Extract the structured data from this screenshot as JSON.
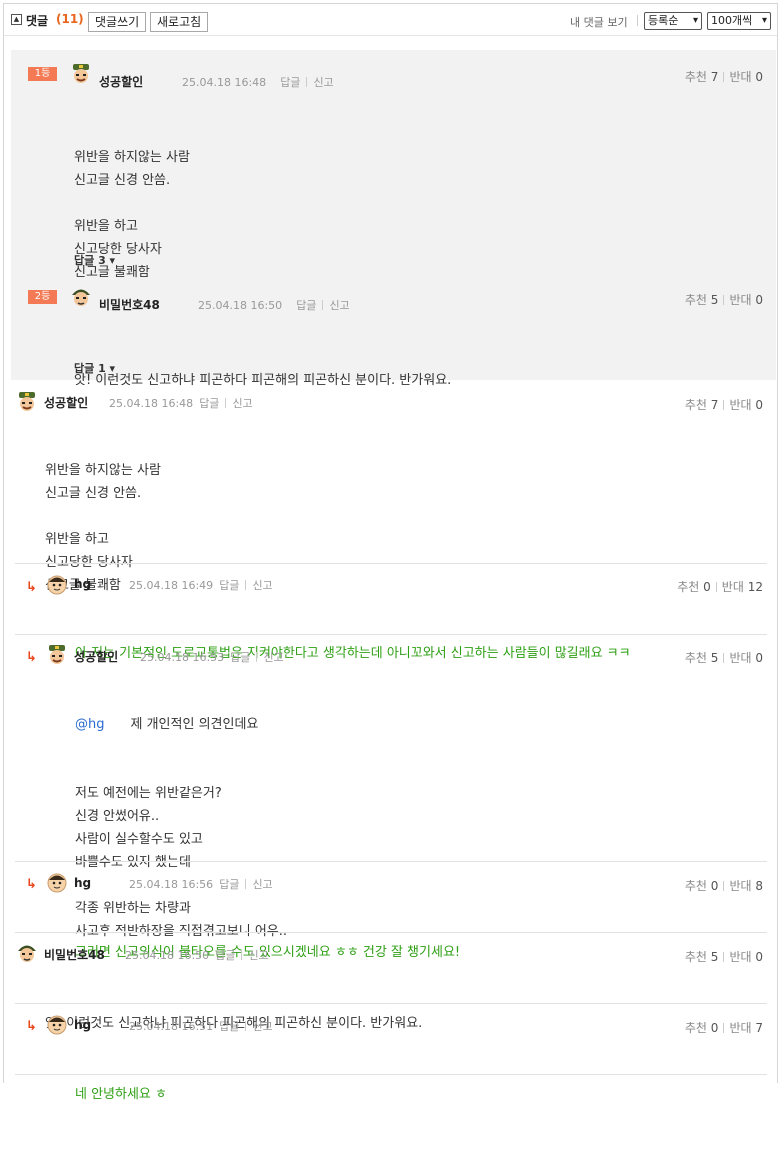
{
  "header": {
    "title": "댓글",
    "count": "(11)",
    "write_label": "댓글쓰기",
    "refresh_label": "새로고침",
    "my_comments_label": "내 댓글 보기",
    "sort_selected": "등록순",
    "per_page_selected": "100개씩"
  },
  "best": [
    {
      "rank": "1등",
      "name": "성공할인",
      "time": "25.04.18 16:48",
      "reply": "답글",
      "report": "신고",
      "recommend_label": "추천",
      "recommend": "7",
      "oppose_label": "반대",
      "oppose": "0",
      "lines": [
        "위반을 하지않는 사람",
        "신고글 신경 안씀.",
        "",
        "위반을 하고",
        "신고당한 당사자",
        "신고글 불쾌함"
      ],
      "replies_toggle": "답글 3 ▾"
    },
    {
      "rank": "2등",
      "name": "비밀번호48",
      "time": "25.04.18 16:50",
      "reply": "답글",
      "report": "신고",
      "recommend_label": "추천",
      "recommend": "5",
      "oppose_label": "반대",
      "oppose": "0",
      "lines": [
        "앗! 이런것도 신고하냐 피곤하다 피곤해의 피곤하신 분이다. 반가워요."
      ],
      "replies_toggle": "답글 1 ▾"
    }
  ],
  "comments": [
    {
      "name": "성공할인",
      "time": "25.04.18 16:48",
      "reply": "답글",
      "report": "신고",
      "recommend_label": "추천",
      "recommend": "7",
      "oppose_label": "반대",
      "oppose": "0",
      "lines": [
        "위반을 하지않는 사람",
        "신고글 신경 안씀.",
        "",
        "위반을 하고",
        "신고당한 당사자",
        "신고글 불쾌함"
      ]
    },
    {
      "name": "hg",
      "time": "25.04.18 16:49",
      "reply": "답글",
      "report": "신고",
      "recommend_label": "추천",
      "recommend": "0",
      "oppose_label": "반대",
      "oppose": "12",
      "lines": [
        "아 저는 기본적인 도로교통법은 지켜야한다고 생각하는데 아니꼬와서 신고하는 사람들이 많길래요 ㅋㅋ"
      ]
    },
    {
      "name": "성공할인",
      "time": "25.04.18 16:53",
      "reply": "답글",
      "report": "신고",
      "recommend_label": "추천",
      "recommend": "5",
      "oppose_label": "반대",
      "oppose": "0",
      "mention": "@hg",
      "lines": [
        "제 개인적인 의견인데요",
        "저도 예전에는 위반같은거?",
        "신경 안썼어유..",
        "사람이 실수할수도 있고",
        "바쁠수도 있지 했는데",
        "",
        "각종 위반하는 차량과",
        "사고후 적반하장을 직접겪고보니 어우.."
      ]
    },
    {
      "name": "hg",
      "time": "25.04.18 16:56",
      "reply": "답글",
      "report": "신고",
      "recommend_label": "추천",
      "recommend": "0",
      "oppose_label": "반대",
      "oppose": "8",
      "lines": [
        "그러면 신고의식이 불타오를 수도 있으시겠네요 ㅎㅎ 건강 잘 챙기세요!"
      ]
    },
    {
      "name": "비밀번호48",
      "time": "25.04.18 16:50",
      "reply": "답글",
      "report": "신고",
      "recommend_label": "추천",
      "recommend": "5",
      "oppose_label": "반대",
      "oppose": "0",
      "lines": [
        "앗! 이런것도 신고하냐 피곤하다 피곤해의 피곤하신 분이다. 반가워요."
      ]
    },
    {
      "name": "hg",
      "time": "25.04.18 16:51",
      "reply": "답글",
      "report": "신고",
      "recommend_label": "추천",
      "recommend": "0",
      "oppose_label": "반대",
      "oppose": "7",
      "lines": [
        "네 안녕하세요 ㅎ"
      ]
    }
  ],
  "colors": {
    "accent": "#e8661d",
    "rank_badge": "#f47a55",
    "reply_text": "#2ea014",
    "mention": "#2b6ccf"
  }
}
